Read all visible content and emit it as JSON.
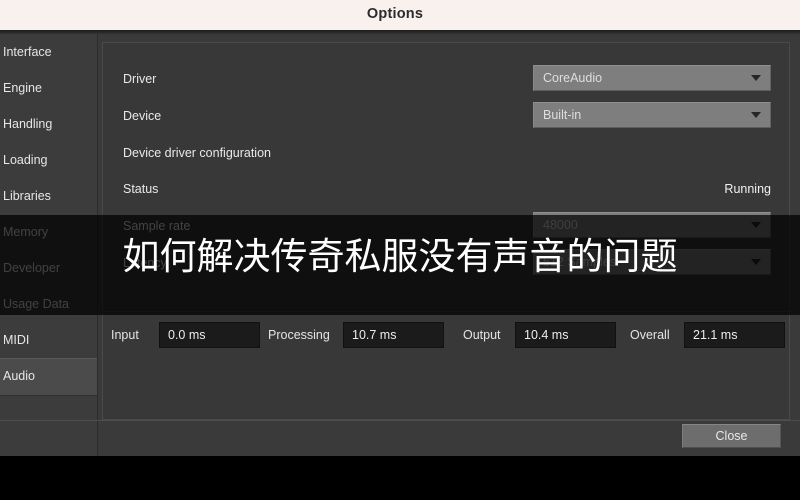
{
  "window": {
    "title": "Options",
    "close_label": "Close"
  },
  "sidebar": {
    "items": [
      {
        "label": "Interface",
        "selected": false
      },
      {
        "label": "Engine",
        "selected": false
      },
      {
        "label": "Handling",
        "selected": false
      },
      {
        "label": "Loading",
        "selected": false
      },
      {
        "label": "Libraries",
        "selected": false
      },
      {
        "label": "Memory",
        "selected": false
      },
      {
        "label": "Developer",
        "selected": false
      },
      {
        "label": "Usage Data",
        "selected": false
      },
      {
        "label": "MIDI",
        "selected": false
      },
      {
        "label": "Audio",
        "selected": true
      }
    ]
  },
  "audio_settings": {
    "driver": {
      "label": "Driver",
      "value": "CoreAudio",
      "icon": "chevron-down-icon"
    },
    "device": {
      "label": "Device",
      "value": "Built-in",
      "icon": "chevron-down-icon"
    },
    "device_driver_configuration": {
      "label": "Device driver configuration"
    },
    "status": {
      "label": "Status",
      "value": "Running"
    },
    "sample_rate": {
      "label": "Sample rate",
      "value": "48000",
      "icon": "chevron-down-icon"
    },
    "buffer_size": {
      "label": "Latency",
      "value": "512 Samples",
      "icon": "chevron-down-icon"
    }
  },
  "latency": {
    "fields": [
      {
        "label": "Input",
        "value": "0.0 ms"
      },
      {
        "label": "Processing",
        "value": "10.7 ms"
      },
      {
        "label": "Output",
        "value": "10.4 ms"
      },
      {
        "label": "Overall",
        "value": "21.1 ms"
      }
    ]
  },
  "overlay": {
    "caption": "如何解决传奇私服没有声音的问题"
  },
  "colors": {
    "titlebar_bg": "#f8f1ed",
    "dialog_bg": "#3a3a3a",
    "panel_bg": "#383838",
    "sidebar_bg": "#3c3c3c",
    "selected_bg": "#4b4b4b",
    "dropdown_bg": "#7e7e7e",
    "readonly_field_bg": "#1b1b1b",
    "text": "#e9e9e9"
  }
}
